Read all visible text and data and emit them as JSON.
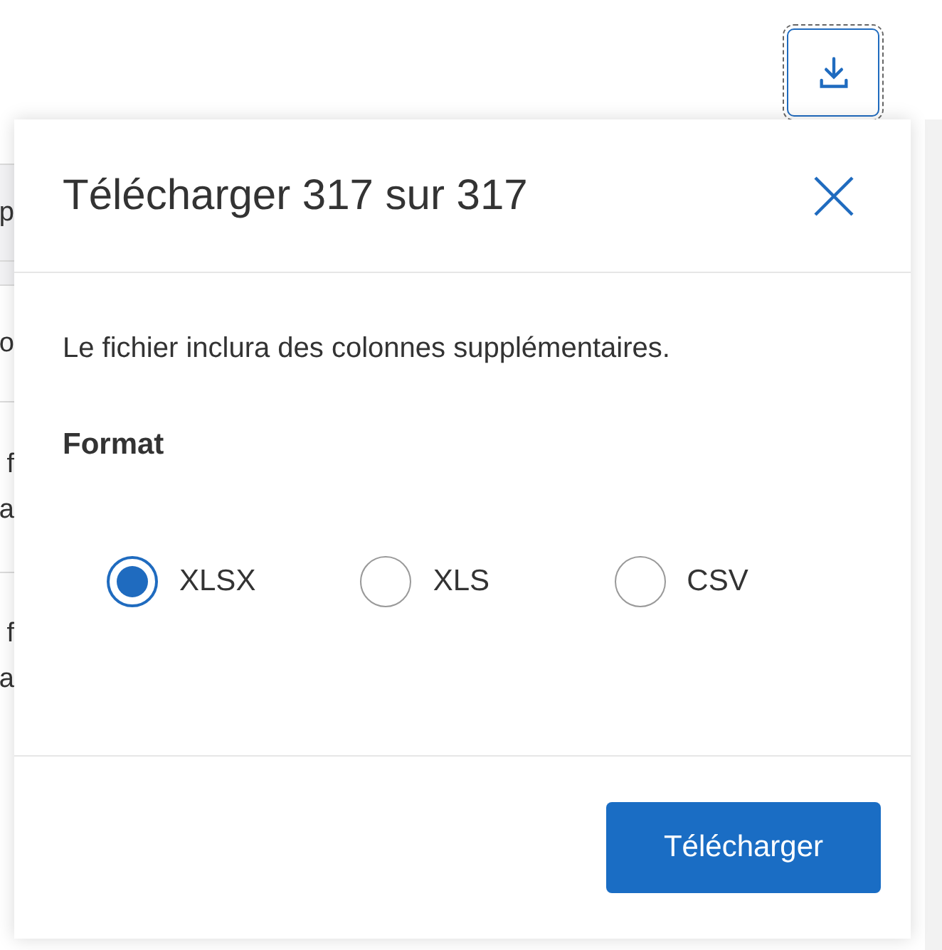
{
  "background_table": {
    "rows": [
      {
        "lines": [
          "p"
        ],
        "shaded": true
      },
      {
        "lines": [],
        "shaded": true
      },
      {
        "lines": [
          "o"
        ],
        "shaded": false
      },
      {
        "lines": [
          "f",
          "a"
        ],
        "shaded": false
      },
      {
        "lines": [
          "f",
          "a"
        ],
        "shaded": false
      }
    ]
  },
  "dialog": {
    "title": "Télécharger 317 sur 317",
    "message": "Le fichier inclura des colonnes supplémentaires.",
    "format_label": "Format",
    "options": [
      {
        "label": "XLSX",
        "selected": true
      },
      {
        "label": "XLS",
        "selected": false
      },
      {
        "label": "CSV",
        "selected": false
      }
    ],
    "submit": "Télécharger"
  }
}
